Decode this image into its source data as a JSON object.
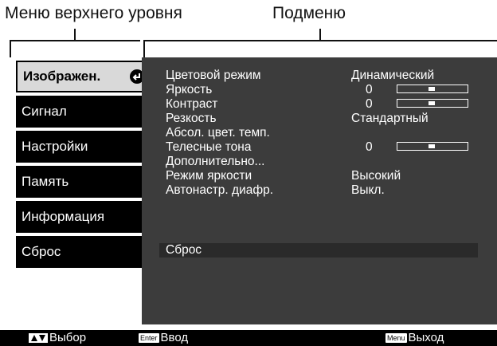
{
  "callouts": {
    "top_level_menu": "Меню верхнего уровня",
    "submenu": "Подменю"
  },
  "left_menu": {
    "items": [
      {
        "label": "Изображен.",
        "selected": true
      },
      {
        "label": "Сигнал",
        "selected": false
      },
      {
        "label": "Настройки",
        "selected": false
      },
      {
        "label": "Память",
        "selected": false
      },
      {
        "label": "Информация",
        "selected": false
      },
      {
        "label": "Сброс",
        "selected": false
      }
    ]
  },
  "submenu": {
    "rows": [
      {
        "label": "Цветовой режим",
        "value": "Динамический"
      },
      {
        "label": "Яркость",
        "number": "0",
        "slider_position": 0.5
      },
      {
        "label": "Контраст",
        "number": "0",
        "slider_position": 0.5
      },
      {
        "label": "Резкость",
        "value": "Стандартный"
      },
      {
        "label": "Абсол. цвет. темп."
      },
      {
        "label": "Телесные тона",
        "number": "0",
        "slider_position": 0.5
      },
      {
        "label": "Дополнительно..."
      },
      {
        "label": "Режим яркости",
        "value": "Высокий"
      },
      {
        "label": "Автонастр. диафр.",
        "value": "Выкл."
      }
    ],
    "reset_label": "Сброс"
  },
  "bottom_bar": {
    "select_label": "Выбор",
    "enter_key": "Enter",
    "enter_label": "Ввод",
    "menu_key": "Menu",
    "exit_label": "Выход"
  },
  "colors": {
    "panel_bg": "#3c3c3c",
    "menu_bg": "#000000",
    "selected_bg": "#d9d9d9",
    "text_light": "#ffffff"
  }
}
